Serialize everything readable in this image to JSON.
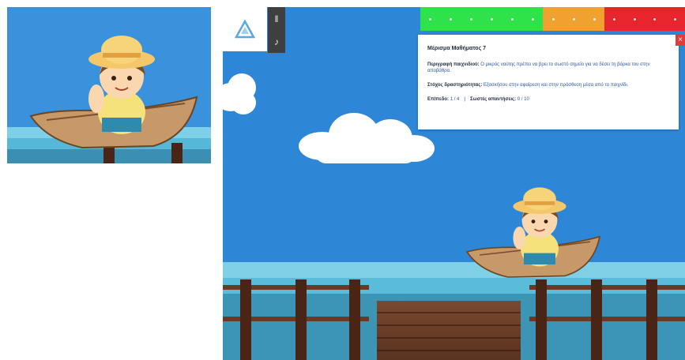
{
  "preview": {
    "character": "boy-in-boat"
  },
  "controls": {
    "logo_icon": "triangle-logo-icon",
    "top_icon": "pause-icon",
    "bottom_icon": "sound-icon"
  },
  "progress": {
    "segments": [
      {
        "color": "#2ee24a",
        "steps": 6
      },
      {
        "color": "#f0a12f",
        "steps": 3
      },
      {
        "color": "#e8242c",
        "steps": 4
      }
    ]
  },
  "info_panel": {
    "title": "Μέρισμα Μαθήματος 7",
    "p1_label": "Περιγραφή παιχνιδιού:",
    "p1_text": "Ο μικρός ναύτης πρέπει να βρει το σωστό σημείο για να δέσει τη βάρκα του στην αποβάθρα.",
    "p2_label": "Στόχος δραστηριότητας:",
    "p2_text": "Εξασκήσου στην αφαίρεση και στην πρόσθεση μέσα από το παιχνίδι.",
    "stat1_label": "Επίπεδο:",
    "stat1_value": "1 / 4",
    "stat2_label": "Σωστές απαντήσεις:",
    "stat2_value": "0 / 10",
    "close_label": "×"
  },
  "scene": {
    "character": "boy-in-boat",
    "dock": "wooden-pier"
  }
}
